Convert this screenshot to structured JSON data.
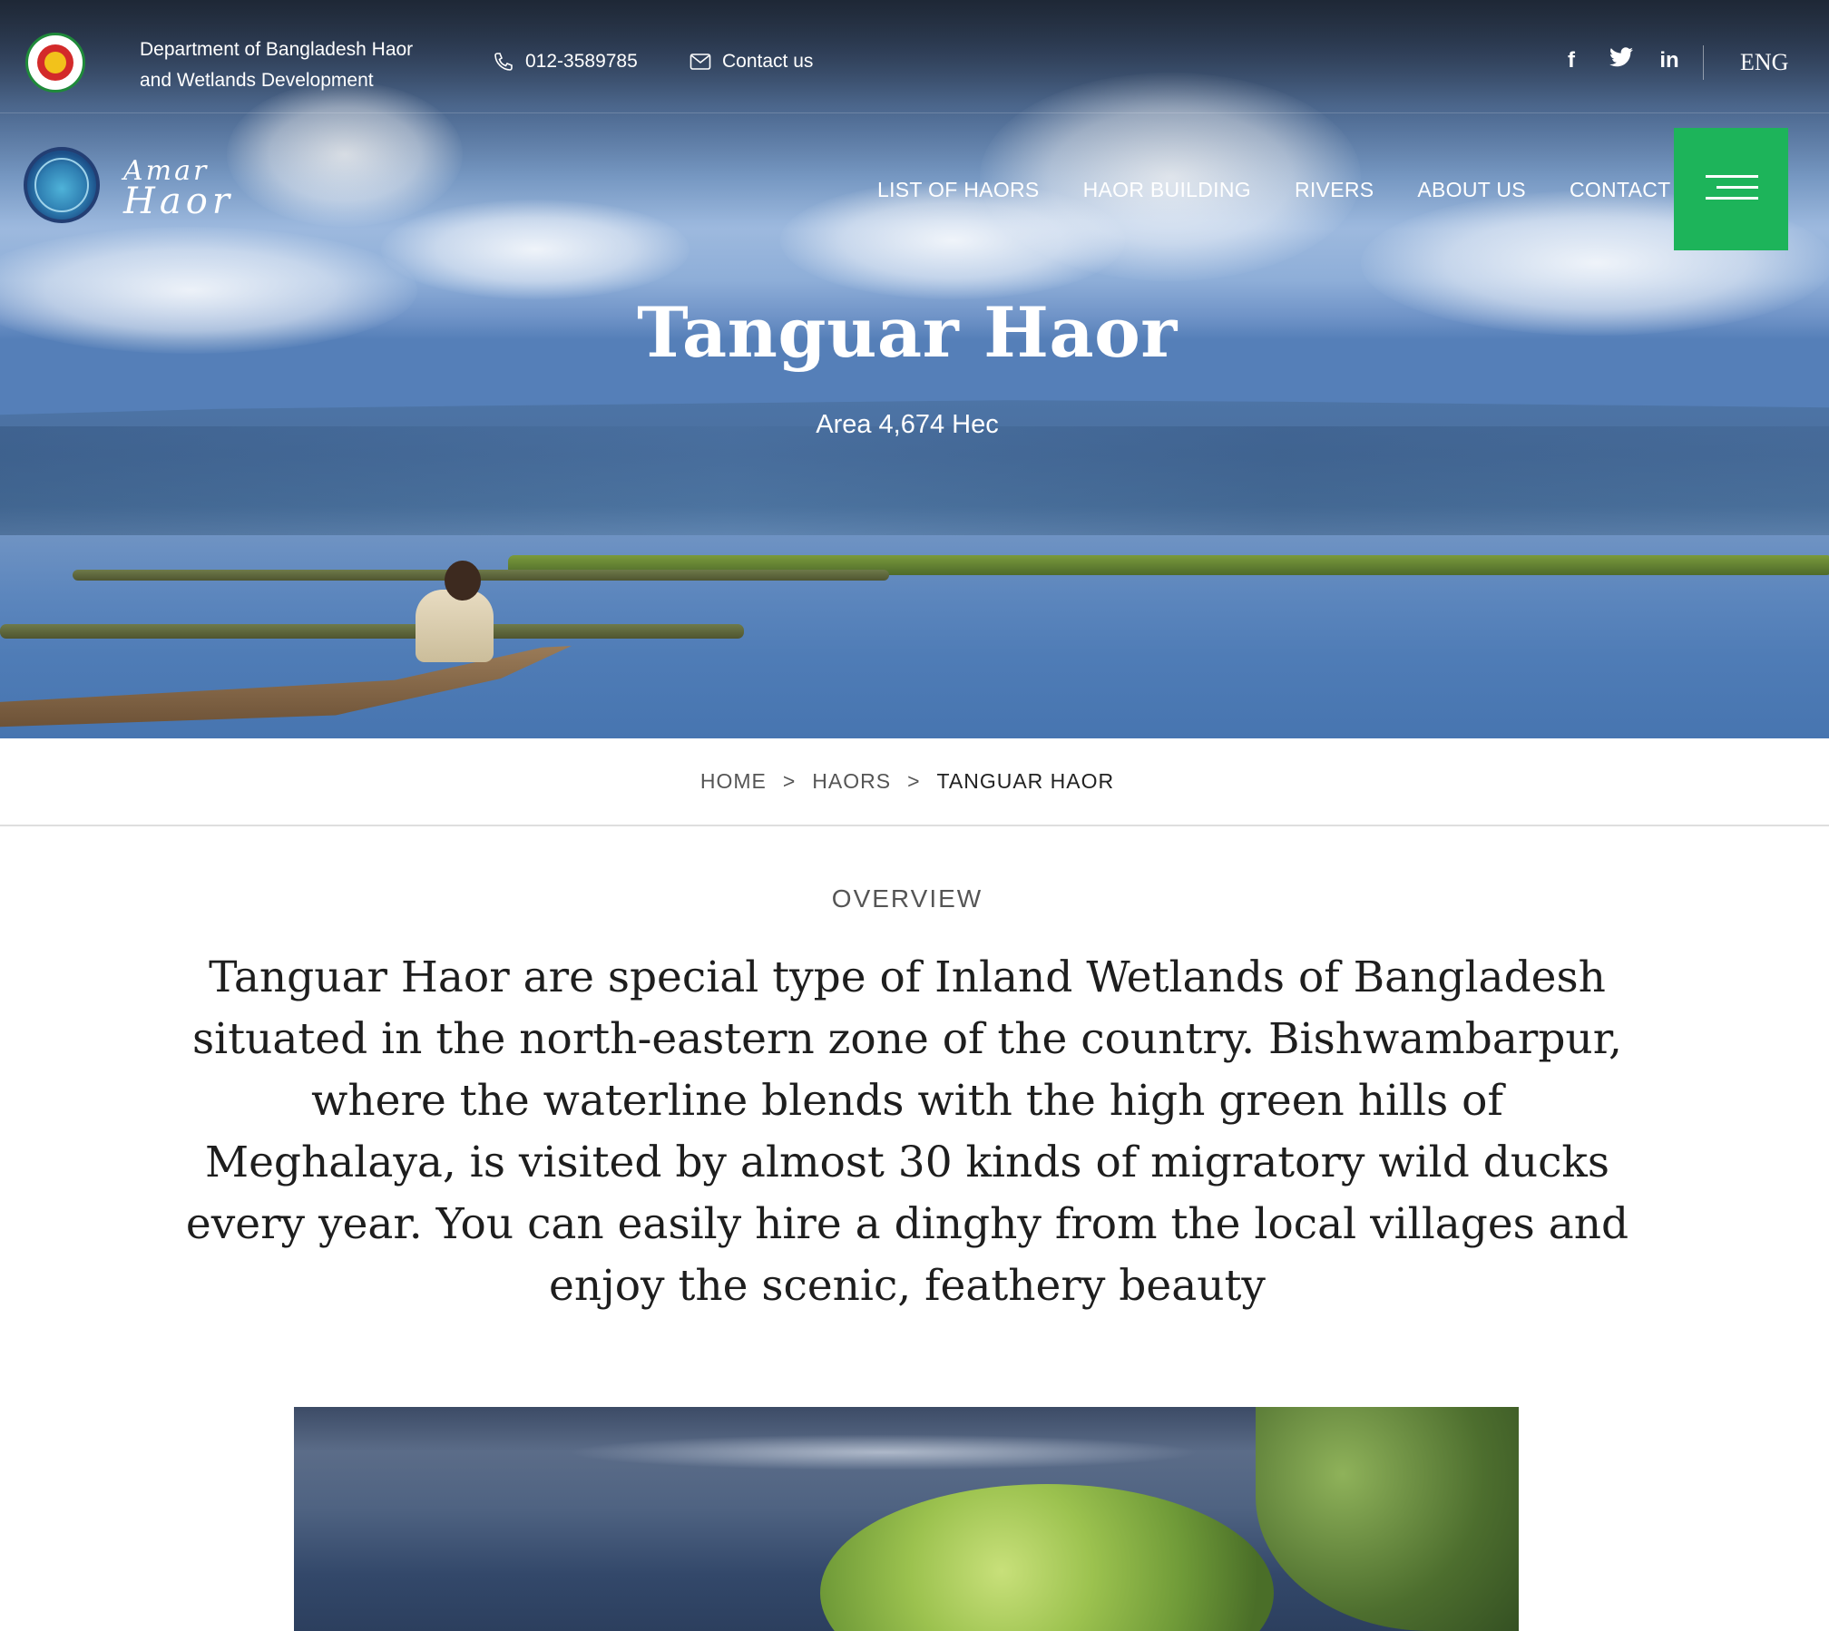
{
  "topbar": {
    "department_line1": "Department of Bangladesh Haor",
    "department_line2": "and Wetlands Development",
    "phone": "012-3589785",
    "contact": "Contact us",
    "social_icons": [
      "facebook-icon",
      "twitter-icon",
      "linkedin-icon"
    ],
    "language": "ENG"
  },
  "nav": {
    "brand_line1": "Amar",
    "brand_line2": "Haor",
    "items": [
      {
        "label": "LIST OF HAORS"
      },
      {
        "label": "HAOR BUILDING"
      },
      {
        "label": "RIVERS"
      },
      {
        "label": "ABOUT US"
      },
      {
        "label": "CONTACT US"
      }
    ],
    "menu_icon": "hamburger-icon",
    "menu_color": "#1db45a"
  },
  "hero": {
    "title": "Tanguar Haor",
    "subtitle": "Area 4,674 Hec"
  },
  "breadcrumb": {
    "items": [
      "HOME",
      "HAORS",
      "TANGUAR HAOR"
    ],
    "separator": ">"
  },
  "overview": {
    "label": "OVERVIEW",
    "text": "Tanguar Haor are special type of Inland Wetlands of Bangladesh situated in the north-eastern zone of the country. Bishwambarpur, where the waterline blends with the high green hills of Meghalaya, is visited by almost 30 kinds of migratory wild ducks every year. You can easily hire a dinghy from the local villages and enjoy the scenic, feathery beauty"
  }
}
